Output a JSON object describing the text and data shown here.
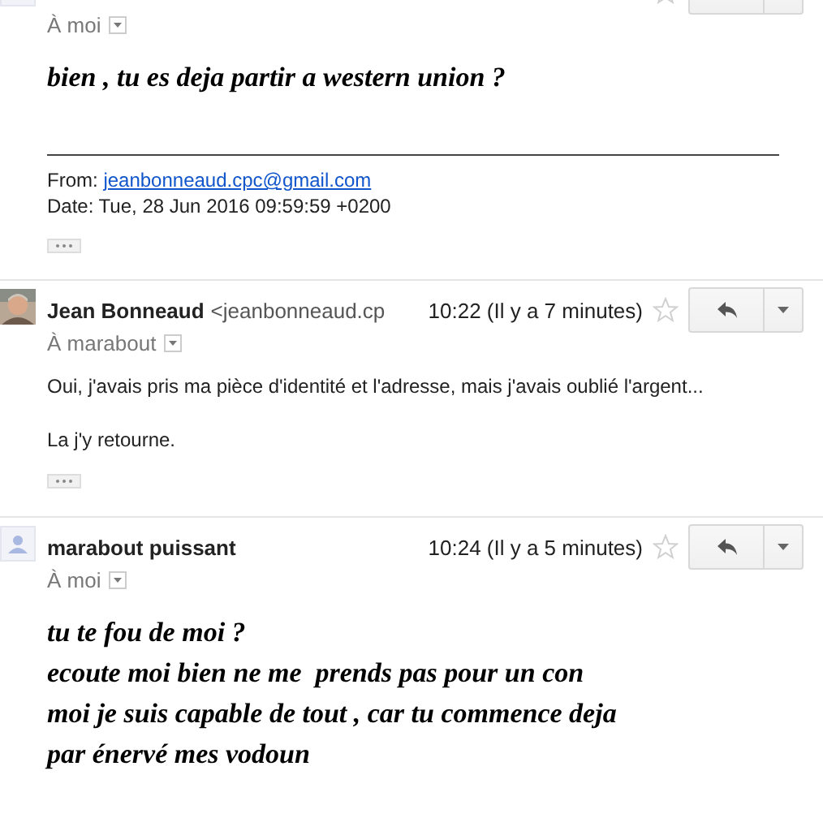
{
  "messages": [
    {
      "header_cut": true,
      "avatar": {
        "kind": "generic"
      },
      "starred": false,
      "recipient": "À moi",
      "body": {
        "kind": "script",
        "paragraphs": [
          "bien , tu es deja partir a western union ?"
        ]
      },
      "quote": {
        "from_label": "From:",
        "from_email": "jeanbonneaud.cpc@gmail.com",
        "date_line": "Date: Tue, 28 Jun 2016 09:59:59 +0200"
      },
      "has_more": true
    },
    {
      "header_cut": false,
      "sender": "Jean Bonneaud",
      "sender_email": "<jeanbonneaud.cp",
      "time": "10:22 (Il y a 7 minutes)",
      "starred": false,
      "recipient": "À marabout",
      "body": {
        "kind": "plain",
        "paragraphs": [
          "Oui, j'avais pris ma pièce d'identité et l'adresse, mais j'avais oublié l'argent...",
          "La j'y retourne."
        ]
      },
      "has_more": true
    },
    {
      "header_cut": false,
      "avatar": {
        "kind": "generic"
      },
      "sender": "marabout puissant",
      "time": "10:24 (Il y a 5 minutes)",
      "starred": false,
      "recipient": "À moi",
      "body": {
        "kind": "script",
        "paragraphs": [
          "tu te fou de moi ?",
          "ecoute moi bien ne me  prends pas pour un con",
          "moi je suis capable de tout , car tu commence deja",
          "par énervé mes vodoun"
        ]
      },
      "has_more": false
    }
  ]
}
